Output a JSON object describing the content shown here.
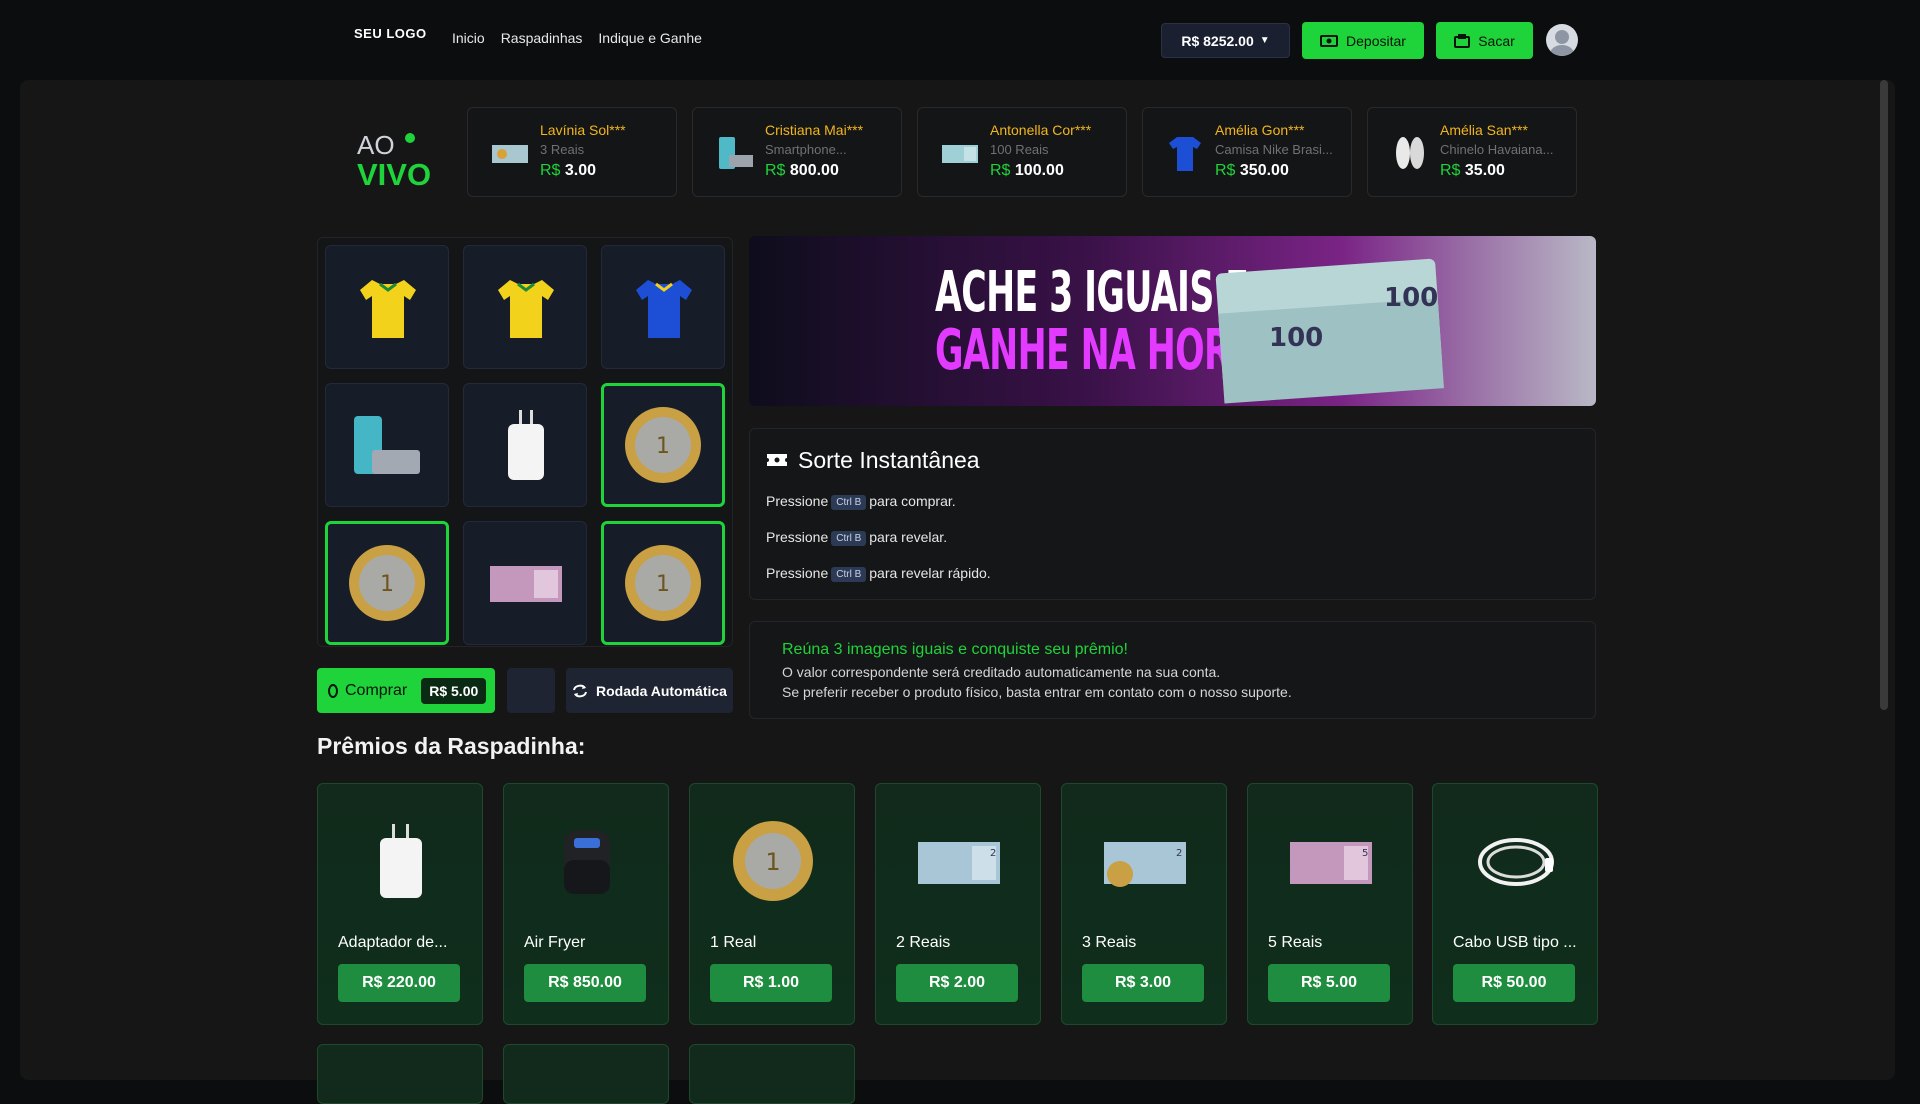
{
  "header": {
    "logo_text": "SEU LOGO",
    "nav": [
      "Inicio",
      "Raspadinhas",
      "Indique e Ganhe"
    ],
    "balance": "R$ 8252.00",
    "deposit_label": "Depositar",
    "withdraw_label": "Sacar"
  },
  "live": {
    "title_top": "AO",
    "title_bottom": "VIVO",
    "winners": [
      {
        "name": "Lavínia Sol***",
        "product": "3 Reais",
        "currency": "R$",
        "value": "3.00"
      },
      {
        "name": "Cristiana Mai***",
        "product": "Smartphone...",
        "currency": "R$",
        "value": "800.00"
      },
      {
        "name": "Antonella Cor***",
        "product": "100 Reais",
        "currency": "R$",
        "value": "100.00"
      },
      {
        "name": "Amélia Gon***",
        "product": "Camisa Nike Brasi...",
        "currency": "R$",
        "value": "350.00"
      },
      {
        "name": "Amélia San***",
        "product": "Chinelo Havaiana...",
        "currency": "R$",
        "value": "35.00"
      }
    ]
  },
  "game": {
    "buy_label": "Comprar",
    "buy_price": "R$ 5.00",
    "auto_label": "Rodada Automática"
  },
  "banner": {
    "line1": "ACHE 3 IGUAIS E",
    "line2": "GANHE NA HORA"
  },
  "instant": {
    "title": "Sorte Instantânea",
    "press": "Pressione",
    "key": "Ctrl B",
    "hint_buy": "para comprar.",
    "hint_reveal": "para revelar.",
    "hint_fast": "para revelar rápido."
  },
  "info": {
    "headline": "Reúna 3 imagens iguais e conquiste seu prêmio!",
    "line1": "O valor correspondente será creditado automaticamente na sua conta.",
    "line2": "Se preferir receber o produto físico, basta entrar em contato com o nosso suporte."
  },
  "prizes": {
    "title": "Prêmios da Raspadinha:",
    "items": [
      {
        "name": "Adaptador de...",
        "price": "R$ 220.00",
        "icon": "charger-icon"
      },
      {
        "name": "Air Fryer",
        "price": "R$ 850.00",
        "icon": "air-fryer-icon"
      },
      {
        "name": "1 Real",
        "price": "R$ 1.00",
        "icon": "coin-icon"
      },
      {
        "name": "2 Reais",
        "price": "R$ 2.00",
        "icon": "banknote-icon"
      },
      {
        "name": "3 Reais",
        "price": "R$ 3.00",
        "icon": "banknote-coin-icon"
      },
      {
        "name": "5 Reais",
        "price": "R$ 5.00",
        "icon": "banknote-icon"
      },
      {
        "name": "Cabo USB tipo ...",
        "price": "R$ 50.00",
        "icon": "usb-cable-icon"
      }
    ]
  },
  "colors": {
    "accent": "#1fd33a",
    "winner_name": "#f2b61d",
    "prize_card": "#112a1b"
  }
}
